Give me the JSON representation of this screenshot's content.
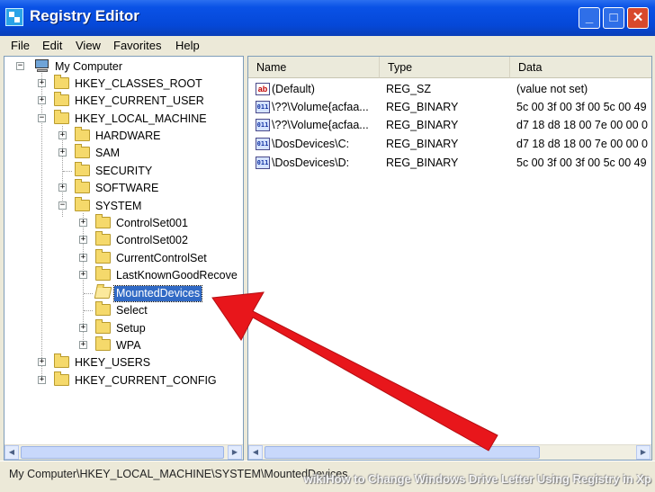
{
  "window": {
    "title": "Registry Editor",
    "controls": {
      "minimize": "_",
      "maximize": "□",
      "close": "✕"
    }
  },
  "menu": [
    "File",
    "Edit",
    "View",
    "Favorites",
    "Help"
  ],
  "tree": {
    "items": [
      {
        "label": "My Computer",
        "expander": "−",
        "icon": "computer-icon"
      },
      {
        "label": "HKEY_CLASSES_ROOT",
        "expander": "+",
        "icon": "folder-icon"
      },
      {
        "label": "HKEY_CURRENT_USER",
        "expander": "+",
        "icon": "folder-icon"
      },
      {
        "label": "HKEY_LOCAL_MACHINE",
        "expander": "−",
        "icon": "folder-icon"
      },
      {
        "label": "HARDWARE",
        "expander": "+",
        "icon": "folder-icon"
      },
      {
        "label": "SAM",
        "expander": "+",
        "icon": "folder-icon"
      },
      {
        "label": "SECURITY",
        "expander": "",
        "icon": "folder-icon"
      },
      {
        "label": "SOFTWARE",
        "expander": "+",
        "icon": "folder-icon"
      },
      {
        "label": "SYSTEM",
        "expander": "−",
        "icon": "folder-icon"
      },
      {
        "label": "ControlSet001",
        "expander": "+",
        "icon": "folder-icon"
      },
      {
        "label": "ControlSet002",
        "expander": "+",
        "icon": "folder-icon"
      },
      {
        "label": "CurrentControlSet",
        "expander": "+",
        "icon": "folder-icon"
      },
      {
        "label": "LastKnownGoodRecove",
        "expander": "+",
        "icon": "folder-icon"
      },
      {
        "label": "MountedDevices",
        "expander": "",
        "icon": "folder-open-icon",
        "selected": true
      },
      {
        "label": "Select",
        "expander": "",
        "icon": "folder-icon"
      },
      {
        "label": "Setup",
        "expander": "+",
        "icon": "folder-icon"
      },
      {
        "label": "WPA",
        "expander": "+",
        "icon": "folder-icon"
      },
      {
        "label": "HKEY_USERS",
        "expander": "+",
        "icon": "folder-icon"
      },
      {
        "label": "HKEY_CURRENT_CONFIG",
        "expander": "+",
        "icon": "folder-icon"
      }
    ]
  },
  "list": {
    "columns": [
      "Name",
      "Type",
      "Data"
    ],
    "rows": [
      {
        "icon": "string-value-icon",
        "icon_text": "ab",
        "name": "(Default)",
        "type": "REG_SZ",
        "data": "(value not set)"
      },
      {
        "icon": "binary-value-icon",
        "icon_text": "011",
        "name": "\\??\\Volume{acfaa...",
        "type": "REG_BINARY",
        "data": "5c 00 3f 00 3f 00 5c 00 49"
      },
      {
        "icon": "binary-value-icon",
        "icon_text": "011",
        "name": "\\??\\Volume{acfaa...",
        "type": "REG_BINARY",
        "data": "d7 18 d8 18 00 7e 00 00 0"
      },
      {
        "icon": "binary-value-icon",
        "icon_text": "011",
        "name": "\\DosDevices\\C:",
        "type": "REG_BINARY",
        "data": "d7 18 d8 18 00 7e 00 00 0"
      },
      {
        "icon": "binary-value-icon",
        "icon_text": "011",
        "name": "\\DosDevices\\D:",
        "type": "REG_BINARY",
        "data": "5c 00 3f 00 3f 00 5c 00 49"
      }
    ]
  },
  "scroll": {
    "left": "◀",
    "right": "▶"
  },
  "statusbar": {
    "path": "My Computer\\HKEY_LOCAL_MACHINE\\SYSTEM\\MountedDevices"
  },
  "watermark": "wikiHow to Change Windows Drive Letter Using Registry in Xp",
  "colors": {
    "annotation_arrow": "#e8161b",
    "selection": "#316ac5",
    "titlebar": "#0a52e6"
  }
}
